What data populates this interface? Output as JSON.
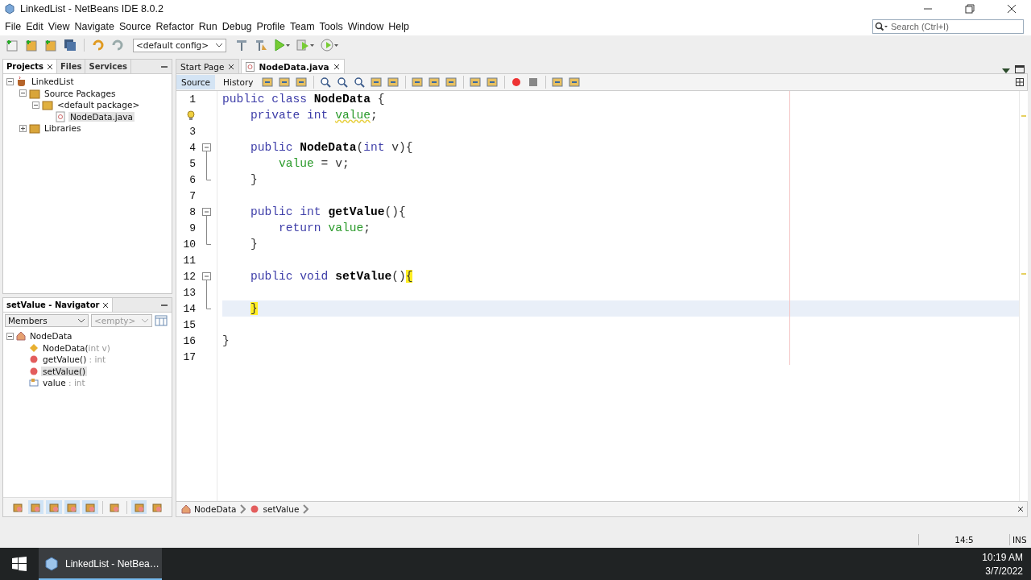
{
  "window": {
    "title": "LinkedList - NetBeans IDE 8.0.2"
  },
  "menu": [
    "File",
    "Edit",
    "View",
    "Navigate",
    "Source",
    "Refactor",
    "Run",
    "Debug",
    "Profile",
    "Team",
    "Tools",
    "Window",
    "Help"
  ],
  "toolbar": {
    "config": "<default config>"
  },
  "search": {
    "placeholder": "Search (Ctrl+I)"
  },
  "projects_panel": {
    "tabs": [
      {
        "label": "Projects",
        "selected": true
      },
      {
        "label": "Files",
        "selected": false
      },
      {
        "label": "Services",
        "selected": false
      }
    ],
    "tree": [
      {
        "label": "LinkedList",
        "kind": "project",
        "expanded": true,
        "selected": false,
        "children": [
          {
            "label": "Source Packages",
            "kind": "folder",
            "expanded": true,
            "selected": false,
            "children": [
              {
                "label": "<default package>",
                "kind": "package",
                "expanded": true,
                "selected": false,
                "children": [
                  {
                    "label": "NodeData.java",
                    "kind": "file",
                    "selected": true
                  }
                ]
              }
            ]
          },
          {
            "label": "Libraries",
            "kind": "folder",
            "expanded": false,
            "selected": false
          }
        ]
      }
    ]
  },
  "navigator": {
    "title": "setValue - Navigator",
    "view": "Members",
    "filter_placeholder": "<empty>",
    "tree": [
      {
        "label": "NodeData",
        "kind": "class",
        "expanded": true,
        "selected": false,
        "children": [
          {
            "label": "NodeData(",
            "detail": "int v)",
            "kind": "constructor",
            "selected": false
          },
          {
            "label": "getValue()",
            "detail": " : int",
            "kind": "method",
            "selected": false
          },
          {
            "label": "setValue()",
            "kind": "method",
            "selected": true
          },
          {
            "label": "value",
            "detail": " : int",
            "kind": "field",
            "selected": false
          }
        ]
      }
    ],
    "filters": [
      {
        "selected": false
      },
      {
        "selected": true
      },
      {
        "selected": true
      },
      {
        "selected": true
      },
      {
        "selected": true
      },
      {
        "selected": false
      },
      {
        "selected": true
      },
      {
        "selected": false
      }
    ]
  },
  "editor": {
    "tabs": [
      {
        "label": "Start Page",
        "selected": false
      },
      {
        "label": "NodeData.java",
        "selected": true
      }
    ],
    "views": [
      {
        "label": "Source",
        "selected": true
      },
      {
        "label": "History",
        "selected": false
      }
    ],
    "lines": [
      {
        "number": "1",
        "kind": "plain",
        "tokens": [
          {
            "kind": "kw",
            "text": "public class "
          },
          {
            "kind": "name",
            "text": "NodeData"
          },
          {
            "kind": "plain",
            "text": " {"
          }
        ]
      },
      {
        "hint": true,
        "kind": "plain",
        "tokens": [
          {
            "kind": "kw",
            "text": "    private int "
          },
          {
            "kind": "field_warn",
            "text": "value"
          },
          {
            "kind": "plain",
            "text": ";"
          }
        ]
      },
      {
        "number": "3",
        "kind": "plain"
      },
      {
        "number": "4",
        "kind": "fold_start",
        "tokens": [
          {
            "kind": "kw",
            "text": "    public "
          },
          {
            "kind": "name",
            "text": "NodeData"
          },
          {
            "kind": "plain",
            "text": "("
          },
          {
            "kind": "kw",
            "text": "int"
          },
          {
            "kind": "plain",
            "text": " v){"
          }
        ]
      },
      {
        "number": "5",
        "kind": "fold_body",
        "tokens": [
          {
            "kind": "field",
            "text": "        value"
          },
          {
            "kind": "plain",
            "text": " = v;"
          }
        ]
      },
      {
        "number": "6",
        "kind": "fold_end",
        "tokens": [
          {
            "kind": "plain",
            "text": "    }"
          }
        ]
      },
      {
        "number": "7",
        "kind": "plain"
      },
      {
        "number": "8",
        "kind": "fold_start",
        "tokens": [
          {
            "kind": "kw",
            "text": "    public int "
          },
          {
            "kind": "name",
            "text": "getValue"
          },
          {
            "kind": "plain",
            "text": "(){"
          }
        ]
      },
      {
        "number": "9",
        "kind": "fold_body",
        "tokens": [
          {
            "kind": "kw",
            "text": "        return "
          },
          {
            "kind": "field",
            "text": "value"
          },
          {
            "kind": "plain",
            "text": ";"
          }
        ]
      },
      {
        "number": "10",
        "kind": "fold_end",
        "tokens": [
          {
            "kind": "plain",
            "text": "    }"
          }
        ]
      },
      {
        "number": "11",
        "kind": "plain"
      },
      {
        "number": "12",
        "kind": "fold_start",
        "tokens": [
          {
            "kind": "kw",
            "text": "    public void "
          },
          {
            "kind": "name",
            "text": "setValue"
          },
          {
            "kind": "plain",
            "text": "()"
          },
          {
            "kind": "match",
            "text": "{"
          }
        ]
      },
      {
        "number": "13",
        "kind": "fold_body"
      },
      {
        "number": "14",
        "kind": "fold_end",
        "current": true,
        "caret": true,
        "tokens": [
          {
            "kind": "match",
            "text": "    }"
          }
        ]
      },
      {
        "number": "15",
        "kind": "plain"
      },
      {
        "number": "16",
        "kind": "plain",
        "tokens": [
          {
            "kind": "plain",
            "text": "}"
          }
        ]
      },
      {
        "number": "17",
        "kind": "plain"
      }
    ],
    "breadcrumbs": [
      {
        "label": "NodeData",
        "kind": "class"
      },
      {
        "label": "setValue",
        "kind": "method"
      }
    ]
  },
  "status_bar": {
    "position": "14:5",
    "mode": "INS"
  },
  "taskbar": {
    "apps": [
      {
        "label": "LinkedList - NetBea…",
        "selected": true
      }
    ],
    "time": "10:19 AM",
    "date": "3/7/2022"
  }
}
